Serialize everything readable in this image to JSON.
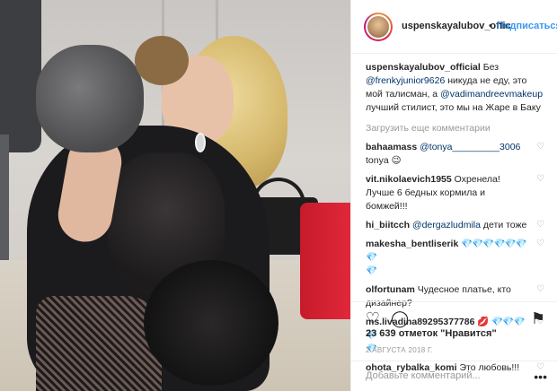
{
  "header": {
    "username": "uspenskayalubov_offic",
    "separator": "•",
    "follow_label": "Подписаться"
  },
  "caption": {
    "username": "uspenskayalubov_official",
    "text_1": "Без",
    "mention_1": "@frenkyjunior9626",
    "text_2": "никуда не еду, это мой талисман, а",
    "mention_2": "@vadimandreevmakeup",
    "text_3": "лучший стилист, это мы на Жаре в Баку"
  },
  "load_more": "Загрузить еще комментарии",
  "comments": [
    {
      "user": "bahaamass",
      "mention": "@tonya_________3006",
      "text": "tonya 😉"
    },
    {
      "user": "vit.nikolaevich1955",
      "text": "Охренела! Лучше 6 бедных кормила и бомжей!!!"
    },
    {
      "user": "hi_biitcch",
      "mention": "@dergazludmila",
      "text": "дети тоже"
    },
    {
      "user": "makesha_bentliserik",
      "gems": "💎💎💎💎💎💎💎",
      "gems2": "💎"
    },
    {
      "user": "olfortunam",
      "text": "Чудесное платье, кто дизайнер?"
    },
    {
      "user": "ms.livadina89295377786",
      "lips": "💋",
      "gems": "💎💎💎💎",
      "gems2": "💎"
    },
    {
      "user": "ohota_rybalka_komi",
      "text": "Это любовь!!!"
    }
  ],
  "icons": {
    "heart": "♡",
    "comment": "◯",
    "bookmark": "⚑",
    "more": "•••"
  },
  "likes": "23 639 отметок \"Нравится\"",
  "date": "2 АВГУСТА 2018 Г.",
  "add_comment_placeholder": "Добавьте комментарий...",
  "colors": {
    "link": "#3897f0",
    "mention": "#003569",
    "muted": "#999999",
    "text": "#262626"
  }
}
